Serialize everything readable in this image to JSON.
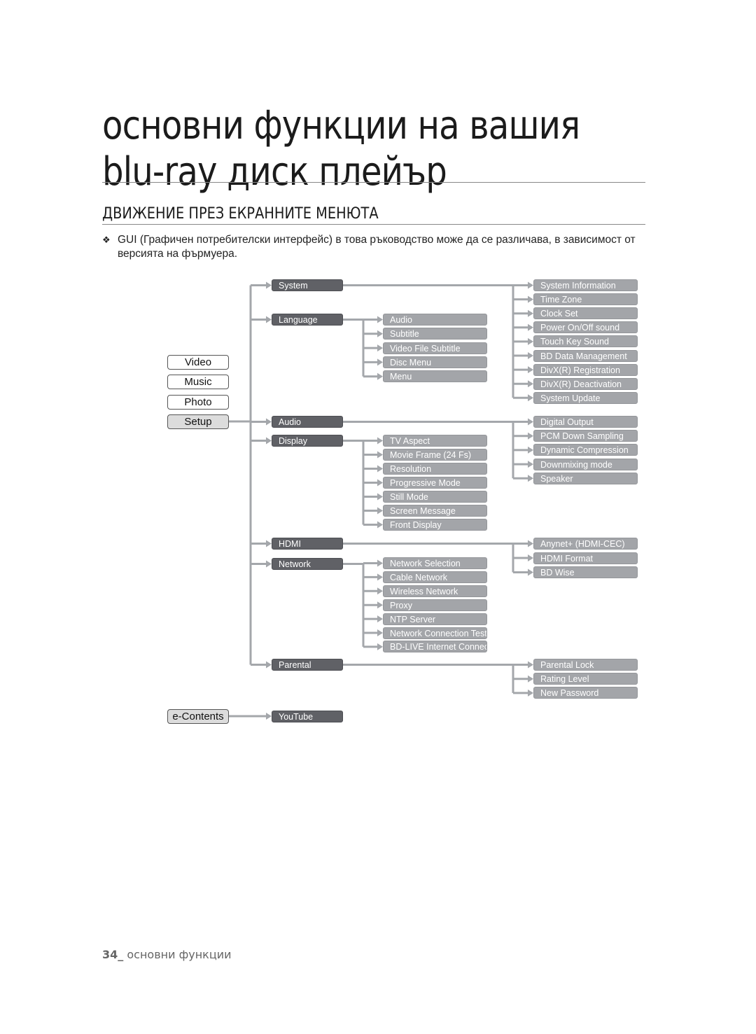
{
  "header": {
    "title_line1": "основни функции на вашия",
    "title_line2": "blu-ray диск плейър"
  },
  "section": {
    "heading": "ДВИЖЕНИЕ ПРЕЗ ЕКРАННИТЕ МЕНЮТА",
    "note_bullet": "❖",
    "note_text": "GUI (Графичен потребителски интерфейс) в това ръководство може да се различава, в зависимост от версията на фърмуера."
  },
  "menu": {
    "roots": [
      {
        "label": "Video",
        "active": false
      },
      {
        "label": "Music",
        "active": false
      },
      {
        "label": "Photo",
        "active": false
      },
      {
        "label": "Setup",
        "active": true
      },
      {
        "label": "e-Contents",
        "active": false
      }
    ],
    "setup_items": [
      {
        "label": "System",
        "children": [
          "System Information",
          "Time Zone",
          "Clock Set",
          "Power On/Off sound",
          "Touch Key Sound",
          "BD Data Management",
          "DivX(R) Registration",
          "DivX(R) Deactivation",
          "System Update"
        ]
      },
      {
        "label": "Language",
        "children": [
          "Audio",
          "Subtitle",
          "Video File Subtitle",
          "Disc Menu",
          "Menu"
        ]
      },
      {
        "label": "Audio",
        "children": [
          "Digital Output",
          "PCM Down Sampling",
          "Dynamic Compression",
          "Downmixing mode",
          "Speaker"
        ]
      },
      {
        "label": "Display",
        "children": [
          "TV Aspect",
          "Movie Frame (24 Fs)",
          "Resolution",
          "Progressive Mode",
          "Still Mode",
          "Screen Message",
          "Front Display"
        ]
      },
      {
        "label": "HDMI",
        "children": [
          "Anynet+ (HDMI-CEC)",
          "HDMI Format",
          "BD Wise"
        ]
      },
      {
        "label": "Network",
        "children": [
          "Network Selection",
          "Cable Network",
          "Wireless Network",
          "Proxy",
          "NTP Server",
          "Network Connection Test",
          "BD-LIVE Internet Connection"
        ]
      },
      {
        "label": "Parental",
        "children": [
          "Parental Lock",
          "Rating Level",
          "New Password"
        ]
      }
    ],
    "econtents_items": [
      {
        "label": "YouTube"
      }
    ]
  },
  "footer": {
    "page_number": "34_",
    "section_name": "основни функции"
  }
}
